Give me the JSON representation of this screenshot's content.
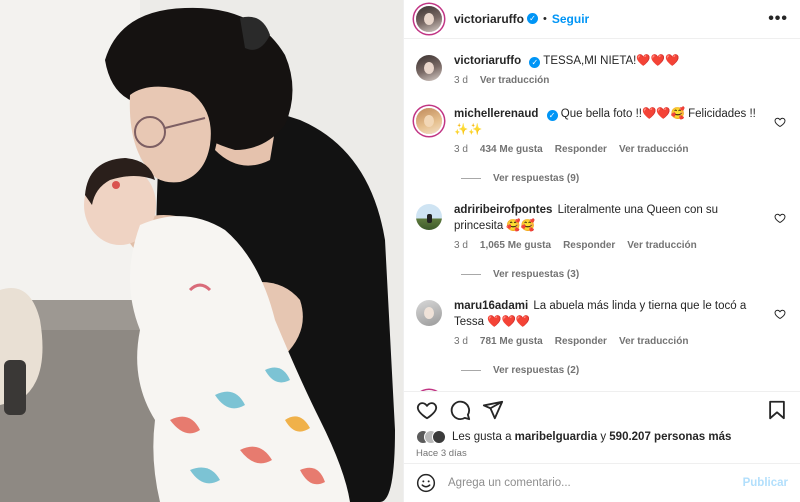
{
  "post": {
    "author": "victoriaruffo",
    "follow_label": "Seguir",
    "more_label": "•••",
    "verified_mark": "✓",
    "separator": "•"
  },
  "caption": {
    "username": "victoriaruffo",
    "text": "TESSA,MI NIETA!❤️❤️❤️",
    "age": "3 d",
    "translate": "Ver traducción"
  },
  "comments": [
    {
      "username": "michellerenaud",
      "verified": true,
      "text": "Que bella foto !!❤️❤️🥰 Felicidades !! ✨✨",
      "age": "3 d",
      "likes": "434 Me gusta",
      "reply": "Responder",
      "translate": "Ver traducción",
      "replies": "Ver respuestas (9)"
    },
    {
      "username": "adriribeirofpontes",
      "verified": false,
      "text": "Literalmente una Queen con su princesita 🥰🥰",
      "age": "3 d",
      "likes": "1,065 Me gusta",
      "reply": "Responder",
      "translate": "Ver traducción",
      "replies": "Ver respuestas (3)"
    },
    {
      "username": "maru16adami",
      "verified": false,
      "text": "La abuela más linda y tierna que le tocó a Tessa ❤️❤️❤️",
      "age": "3 d",
      "likes": "781 Me gusta",
      "reply": "Responder",
      "translate": "Ver traducción",
      "replies": "Ver respuestas (2)"
    }
  ],
  "likes": {
    "prefix": "Les gusta a",
    "user": "maribelguardia",
    "conj": "y",
    "others": "590.207 personas más"
  },
  "posted_ago": "Hace 3 días",
  "add_comment": {
    "placeholder": "Agrega un comentario...",
    "publish_label": "Publicar"
  },
  "icons": [
    "like-icon",
    "comment-icon",
    "share-icon",
    "save-icon",
    "emoji-icon",
    "comment-heart-icon"
  ],
  "colors": {
    "accent": "#0095f6",
    "text": "#262626",
    "muted": "#737373",
    "publish_disabled": "#b2dffc"
  }
}
